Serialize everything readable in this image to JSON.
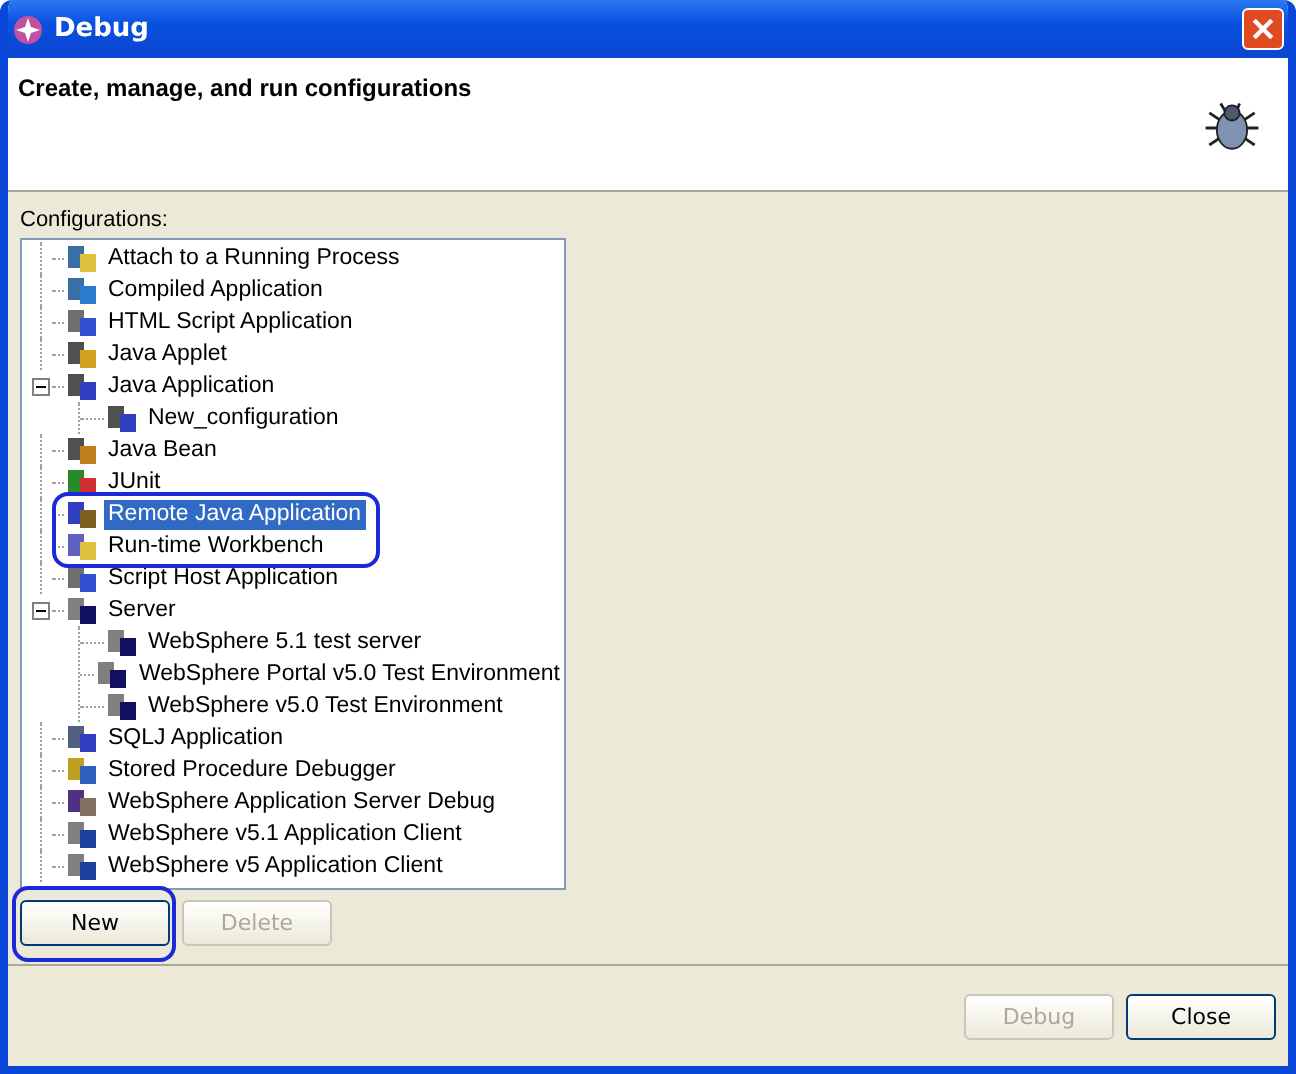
{
  "window": {
    "title": "Debug"
  },
  "header": {
    "heading": "Create, manage, and run configurations"
  },
  "configurations": {
    "label": "Configurations:",
    "items": [
      {
        "label": "Attach to a Running Process",
        "kind": "process",
        "selected": false
      },
      {
        "label": "Compiled Application",
        "kind": "compiled",
        "selected": false
      },
      {
        "label": "HTML Script Application",
        "kind": "script",
        "selected": false
      },
      {
        "label": "Java Applet",
        "kind": "applet",
        "selected": false
      },
      {
        "label": "Java Application",
        "kind": "java",
        "selected": false,
        "expanded": true,
        "children": [
          {
            "label": "New_configuration",
            "kind": "java",
            "selected": false
          }
        ]
      },
      {
        "label": "Java Bean",
        "kind": "bean",
        "selected": false
      },
      {
        "label": "JUnit",
        "kind": "junit",
        "selected": false
      },
      {
        "label": "Remote Java Application",
        "kind": "remote",
        "selected": true
      },
      {
        "label": "Run-time Workbench",
        "kind": "workbench",
        "selected": false
      },
      {
        "label": "Script Host Application",
        "kind": "script",
        "selected": false
      },
      {
        "label": "Server",
        "kind": "server",
        "selected": false,
        "expanded": true,
        "children": [
          {
            "label": "WebSphere 5.1 test server",
            "kind": "server",
            "selected": false
          },
          {
            "label": "WebSphere Portal v5.0 Test Environment",
            "kind": "server",
            "selected": false
          },
          {
            "label": "WebSphere v5.0 Test Environment",
            "kind": "server",
            "selected": false
          }
        ]
      },
      {
        "label": "SQLJ Application",
        "kind": "sqlj",
        "selected": false
      },
      {
        "label": "Stored Procedure Debugger",
        "kind": "procedure",
        "selected": false
      },
      {
        "label": "WebSphere Application Server Debug",
        "kind": "debug",
        "selected": false
      },
      {
        "label": "WebSphere v5.1 Application Client",
        "kind": "client",
        "selected": false
      },
      {
        "label": "WebSphere v5 Application Client",
        "kind": "client",
        "selected": false
      }
    ]
  },
  "list_buttons": [
    {
      "label": "New",
      "disabled": false
    },
    {
      "label": "Delete",
      "disabled": true
    }
  ],
  "dialog_buttons": [
    {
      "label": "Debug",
      "disabled": true
    },
    {
      "label": "Close",
      "disabled": false
    }
  ]
}
